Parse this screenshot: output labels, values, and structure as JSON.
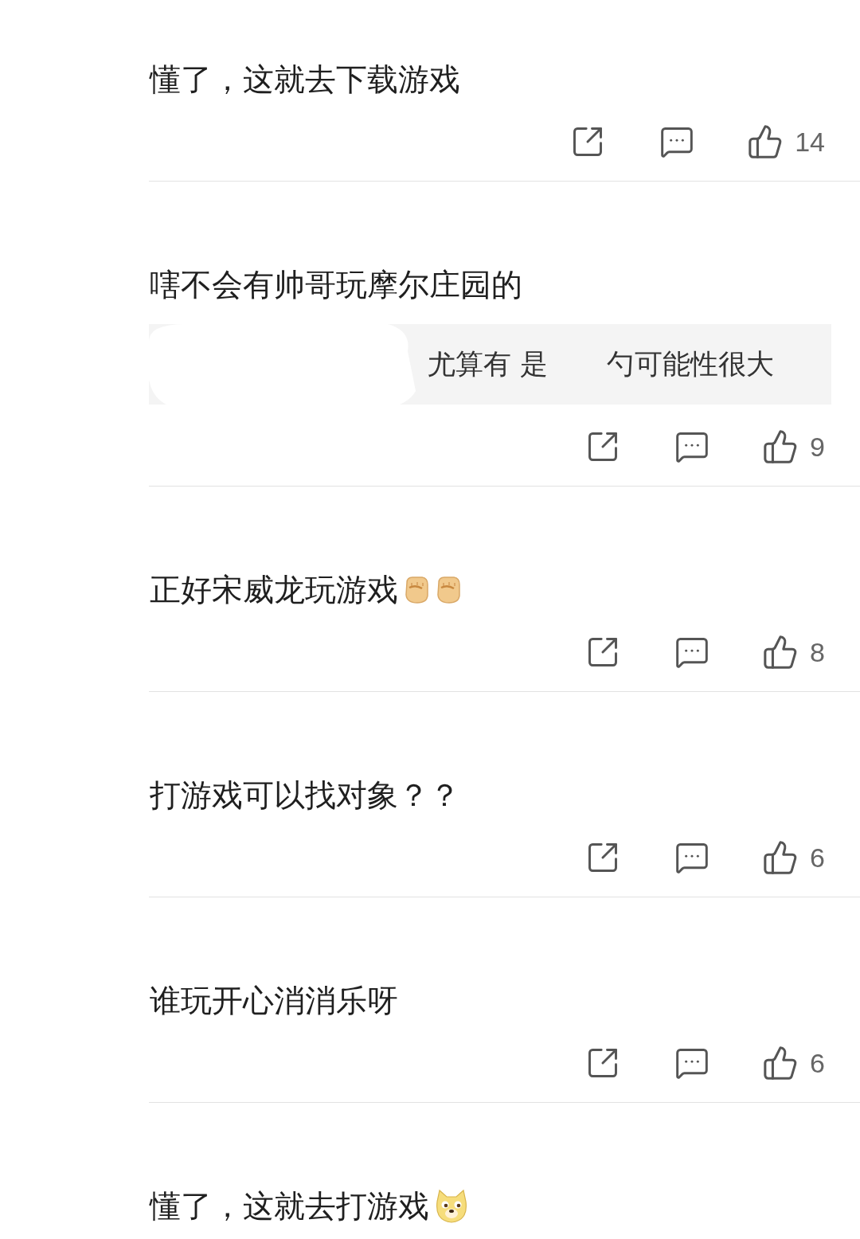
{
  "comments": [
    {
      "text": "懂了，这就去下载游戏",
      "likes": "14"
    },
    {
      "text": "嗐不会有帅哥玩摩尔庄园的",
      "reply": {
        "parts": [
          "尤算有 是",
          "勺可能性很大"
        ]
      },
      "likes": "9"
    },
    {
      "text": "正好宋威龙玩游戏",
      "emojis": [
        {
          "kind": "fist"
        },
        {
          "kind": "fist"
        }
      ],
      "likes": "8"
    },
    {
      "text": "打游戏可以找对象？？",
      "likes": "6"
    },
    {
      "text": "谁玩开心消消乐呀",
      "likes": "6"
    },
    {
      "text": "懂了，这就去打游戏",
      "emojis": [
        {
          "kind": "doge"
        }
      ]
    }
  ]
}
